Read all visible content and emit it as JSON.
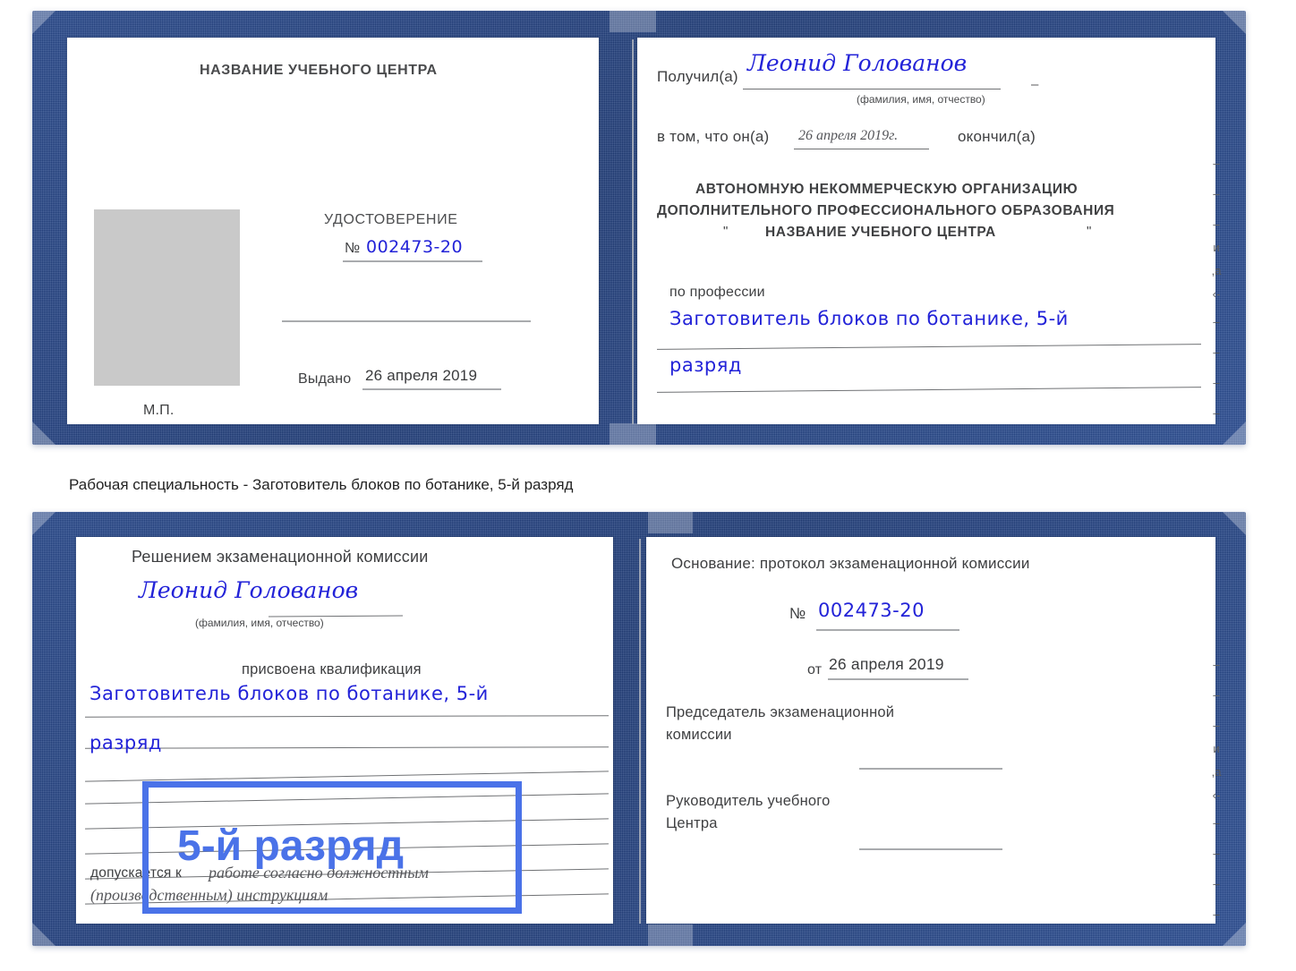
{
  "caption": {
    "text": "Рабочая специальность - Заготовитель блоков по ботанике, 5-й разряд"
  },
  "highlight": {
    "label": "5-й разряд",
    "color": "#4a72e8"
  },
  "colors": {
    "cover": "#234488",
    "handwriting": "#2323d8",
    "rule": "#a9abae",
    "photo_placeholder": "#c9c9c9",
    "body_text": "#58595b"
  },
  "certificate_top": {
    "left_page": {
      "org_title": "НАЗВАНИЕ УЧЕБНОГО ЦЕНТРА",
      "doc_type": "УДОСТОВЕРЕНИЕ",
      "number_prefix": "№",
      "number_value": "002473-20",
      "issued_label": "Выдано",
      "issued_value": "26 апреля 2019",
      "seal_label": "М.П.",
      "photo_alt": "photo-placeholder"
    },
    "right_page": {
      "received_label": "Получил(а)",
      "received_value": "Леонид Голованов",
      "fio_hint": "(фамилия, имя, отчество)",
      "that_he_label": "в том, что он(а)",
      "that_he_value": "26 апреля 2019г.",
      "finished_label": "окончил(а)",
      "org_line1": "АВТОНОМНУЮ НЕКОММЕРЧЕСКУЮ ОРГАНИЗАЦИЮ",
      "org_line2": "ДОПОЛНИТЕЛЬНОГО ПРОФЕССИОНАЛЬНОГО ОБРАЗОВАНИЯ",
      "org_quote_open": "\"",
      "org_line3": "НАЗВАНИЕ УЧЕБНОГО ЦЕНТРА",
      "org_quote_close": "\"",
      "profession_label": "по профессии",
      "profession_value_line1": "Заготовитель блоков по ботанике, 5-й",
      "profession_value_line2": "разряд",
      "clipped_column": [
        "–",
        "–",
        "–",
        "и",
        ",а",
        "‹-",
        "–",
        "–",
        "–",
        "–"
      ]
    }
  },
  "certificate_bottom": {
    "left_page": {
      "decision_title": "Решением экзаменационной комиссии",
      "name_value": "Леонид Голованов",
      "fio_hint": "(фамилия, имя, отчество)",
      "qualification_label": "присвоена квалификация",
      "qualification_line1": "Заготовитель блоков по ботанике, 5-й",
      "qualification_line2": "разряд",
      "admitted_label": "допускается к",
      "admitted_value_line1": "работе согласно должностным",
      "admitted_value_line2": "(производственным) инструкциям"
    },
    "right_page": {
      "basis_label": "Основание: протокол экзаменационной комиссии",
      "number_prefix": "№",
      "number_value": "002473-20",
      "date_prefix": "от",
      "date_value": "26 апреля 2019",
      "chairman_line1": "Председатель экзаменационной",
      "chairman_line2": "комиссии",
      "head_line1": "Руководитель учебного",
      "head_line2": "Центра",
      "clipped_column": [
        "–",
        "–",
        "–",
        "и",
        ",а",
        "‹-",
        "–",
        "–",
        "–",
        "–"
      ]
    }
  }
}
